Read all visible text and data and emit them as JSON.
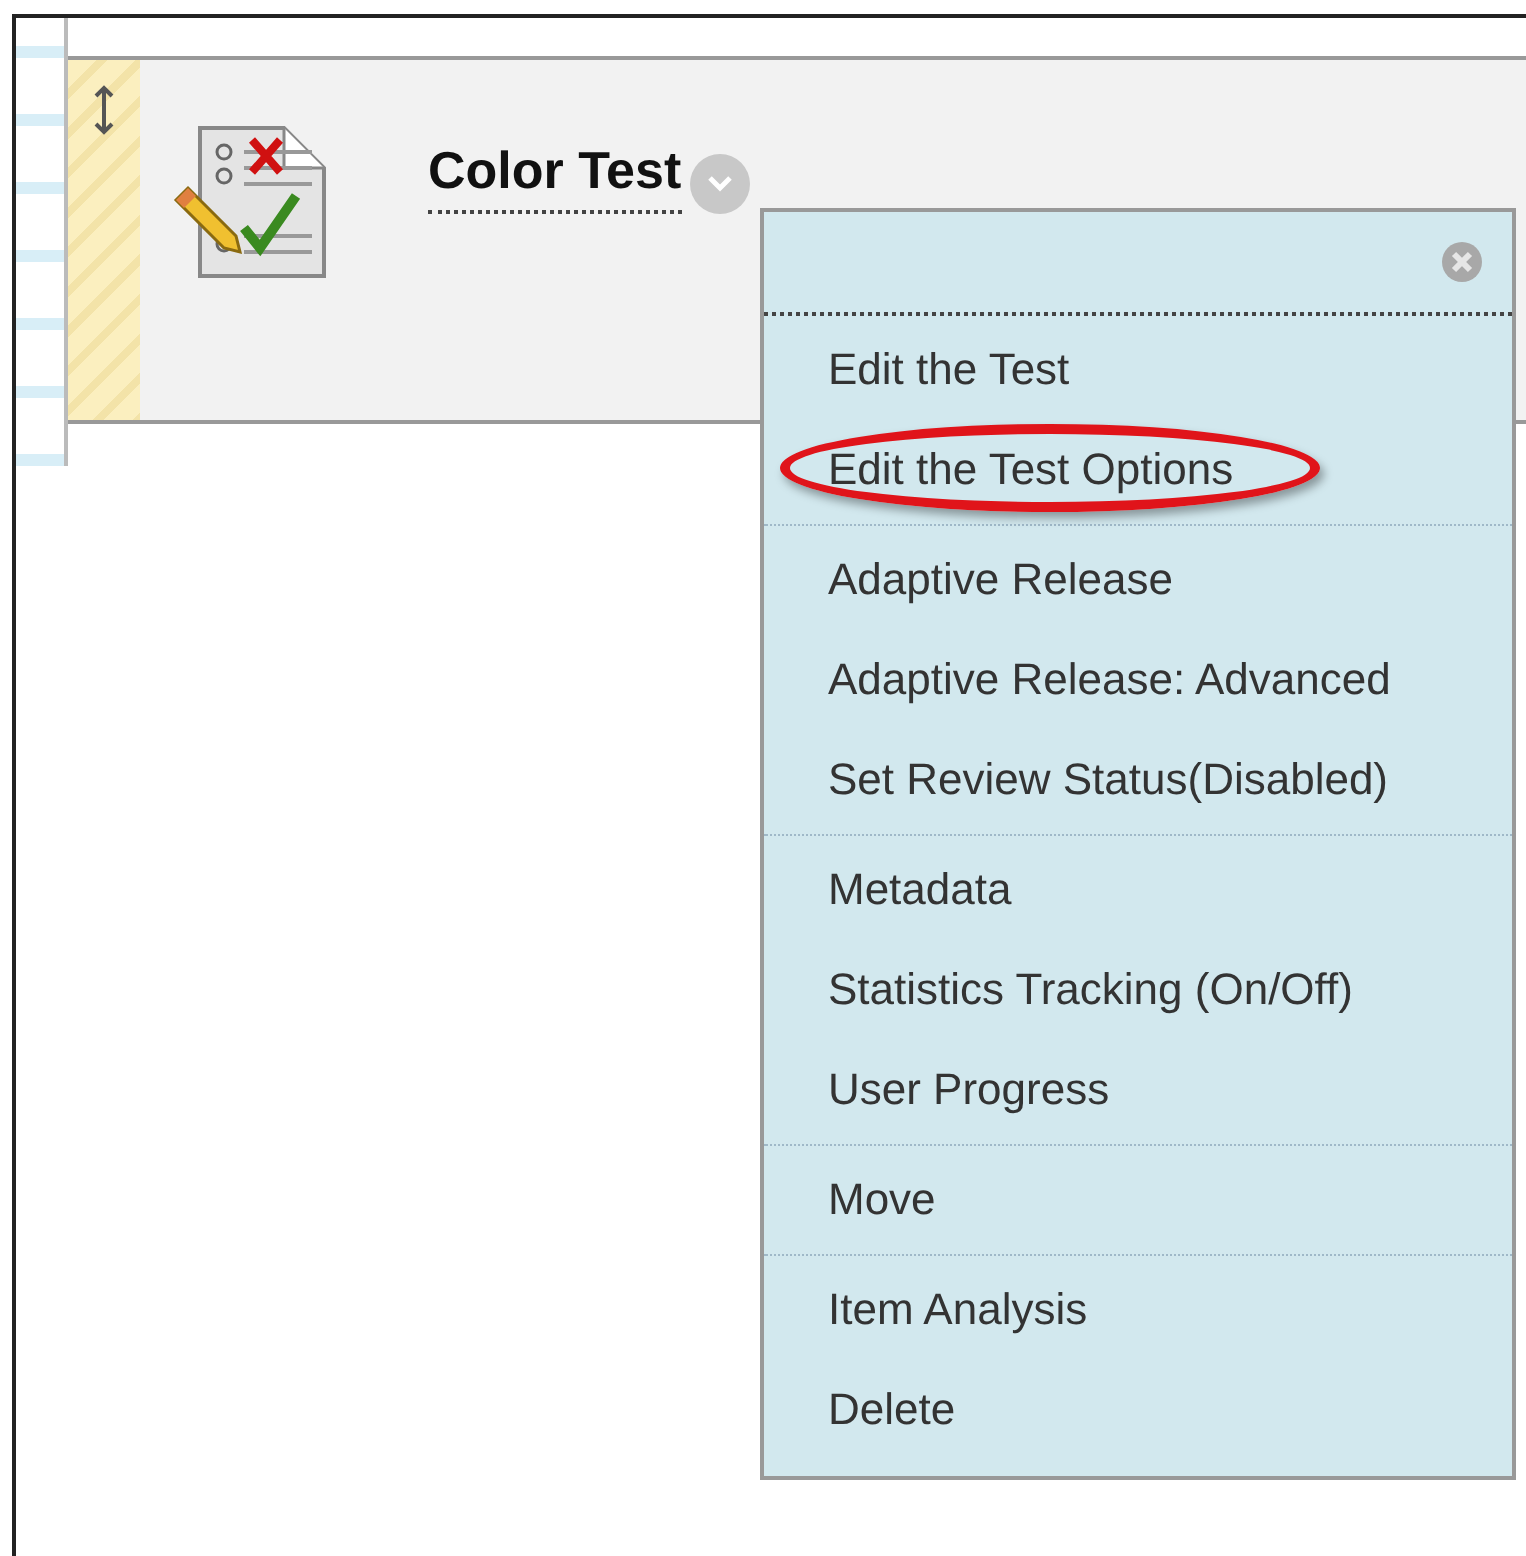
{
  "item": {
    "title": "Color Test"
  },
  "menu": {
    "groups": [
      {
        "items": [
          {
            "label": "Edit the Test",
            "highlighted": false
          },
          {
            "label": "Edit the Test Options",
            "highlighted": true
          }
        ]
      },
      {
        "items": [
          {
            "label": "Adaptive Release",
            "highlighted": false
          },
          {
            "label": "Adaptive Release: Advanced",
            "highlighted": false
          },
          {
            "label": "Set Review Status(Disabled)",
            "highlighted": false
          }
        ]
      },
      {
        "items": [
          {
            "label": "Metadata",
            "highlighted": false
          },
          {
            "label": "Statistics Tracking (On/Off)",
            "highlighted": false
          },
          {
            "label": "User Progress",
            "highlighted": false
          }
        ]
      },
      {
        "items": [
          {
            "label": "Move",
            "highlighted": false
          }
        ]
      },
      {
        "items": [
          {
            "label": "Item Analysis",
            "highlighted": false
          },
          {
            "label": "Delete",
            "highlighted": false
          }
        ]
      }
    ]
  }
}
